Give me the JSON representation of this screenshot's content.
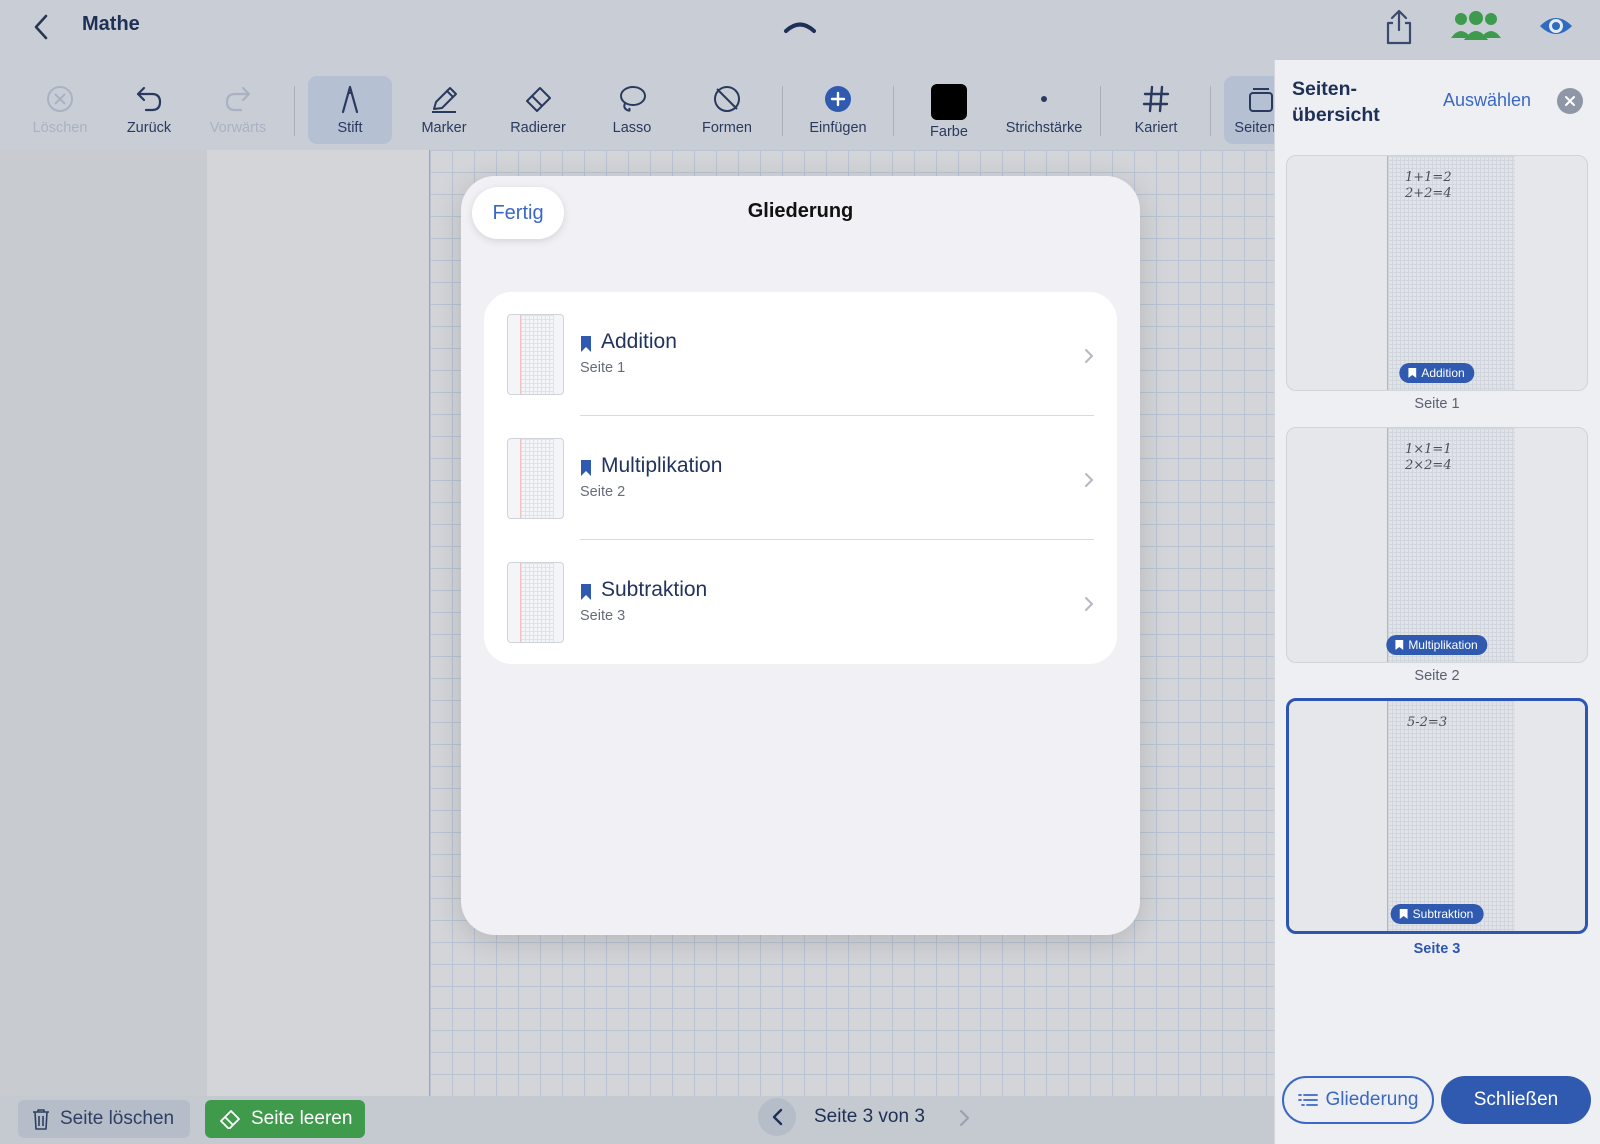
{
  "header": {
    "title": "Mathe"
  },
  "toolbar": {
    "items": [
      {
        "label": "Löschen"
      },
      {
        "label": "Zurück"
      },
      {
        "label": "Vorwärts"
      },
      {
        "label": "Stift"
      },
      {
        "label": "Marker"
      },
      {
        "label": "Radierer"
      },
      {
        "label": "Lasso"
      },
      {
        "label": "Formen"
      },
      {
        "label": "Einfügen"
      },
      {
        "label": "Farbe"
      },
      {
        "label": "Strichstärke"
      },
      {
        "label": "Kariert"
      },
      {
        "label": "Seitenü"
      }
    ],
    "active_tool": "Stift",
    "current_color": "#000000"
  },
  "modal": {
    "done_label": "Fertig",
    "title": "Gliederung",
    "entries": [
      {
        "name": "Addition",
        "page": "Seite 1"
      },
      {
        "name": "Multiplikation",
        "page": "Seite 2"
      },
      {
        "name": "Subtraktion",
        "page": "Seite 3"
      }
    ]
  },
  "panel": {
    "title": "Seiten-\nübersicht",
    "select_label": "Auswählen",
    "pages": [
      {
        "label": "Seite 1",
        "badge": "Addition",
        "handwriting": "1+1=2\n2+2=4",
        "selected": false
      },
      {
        "label": "Seite 2",
        "badge": "Multiplikation",
        "handwriting": "1×1=1\n2×2=4",
        "selected": false
      },
      {
        "label": "Seite 3",
        "badge": "Subtraktion",
        "handwriting": "5-2=3",
        "selected": true
      }
    ],
    "outline_button": "Gliederung",
    "close_button": "Schließen"
  },
  "bottombar": {
    "delete_page": "Seite löschen",
    "clear_page": "Seite leeren",
    "page_indicator": "Seite 3 von 3"
  },
  "colors": {
    "accent": "#2f5ab0",
    "green": "#3f9a4c"
  }
}
